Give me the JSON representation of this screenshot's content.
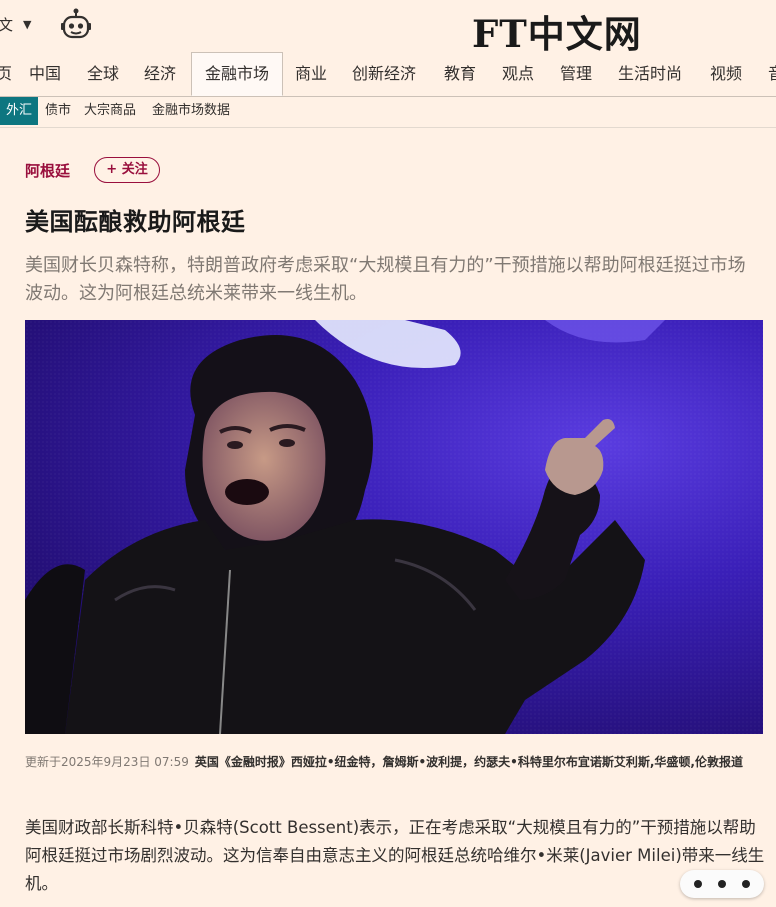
{
  "header": {
    "lang_label": "文",
    "lang_caret": "▼",
    "logo_text": "FT中文网"
  },
  "nav": {
    "items": [
      {
        "label": "页"
      },
      {
        "label": "中国"
      },
      {
        "label": "全球"
      },
      {
        "label": "经济"
      },
      {
        "label": "金融市场",
        "active": true
      },
      {
        "label": "商业"
      },
      {
        "label": "创新经济"
      },
      {
        "label": "教育"
      },
      {
        "label": "观点"
      },
      {
        "label": "管理"
      },
      {
        "label": "生活时尚"
      },
      {
        "label": "视频"
      },
      {
        "label": "音"
      }
    ]
  },
  "subnav": {
    "items": [
      {
        "label": "外汇",
        "active": true
      },
      {
        "label": "债市"
      },
      {
        "label": "大宗商品"
      },
      {
        "label": "金融市场数据"
      }
    ]
  },
  "article": {
    "topic": "阿根廷",
    "follow_label": "+ 关注",
    "headline": "美国酝酿救助阿根廷",
    "standfirst": "美国财长贝森特称，特朗普政府考虑采取“大规模且有力的”干预措施以帮助阿根廷挺过市场波动。这为阿根廷总统米莱带来一线生机。",
    "updated": "更新于2025年9月23日 07:59",
    "authors": "英国《金融时报》西娅拉•纽金特，詹姆斯•波利提，约瑟夫•科特里尔布宜诺斯艾利斯,华盛顿,伦敦报道",
    "body": "美国财政部长斯科特•贝森特(Scott Bessent)表示，正在考虑采取“大规模且有力的”干预措施以帮助阿根廷挺过市场剧烈波动。这为信奉自由意志主义的阿根廷总统哈维尔•米莱(Javier Milei)带来一线生机。"
  },
  "icons": {
    "robot": "robot-icon",
    "more": "more-dots-icon"
  },
  "colors": {
    "background": "#fff1e5",
    "topic": "#990f3d",
    "subnav_active": "#0d7680"
  }
}
